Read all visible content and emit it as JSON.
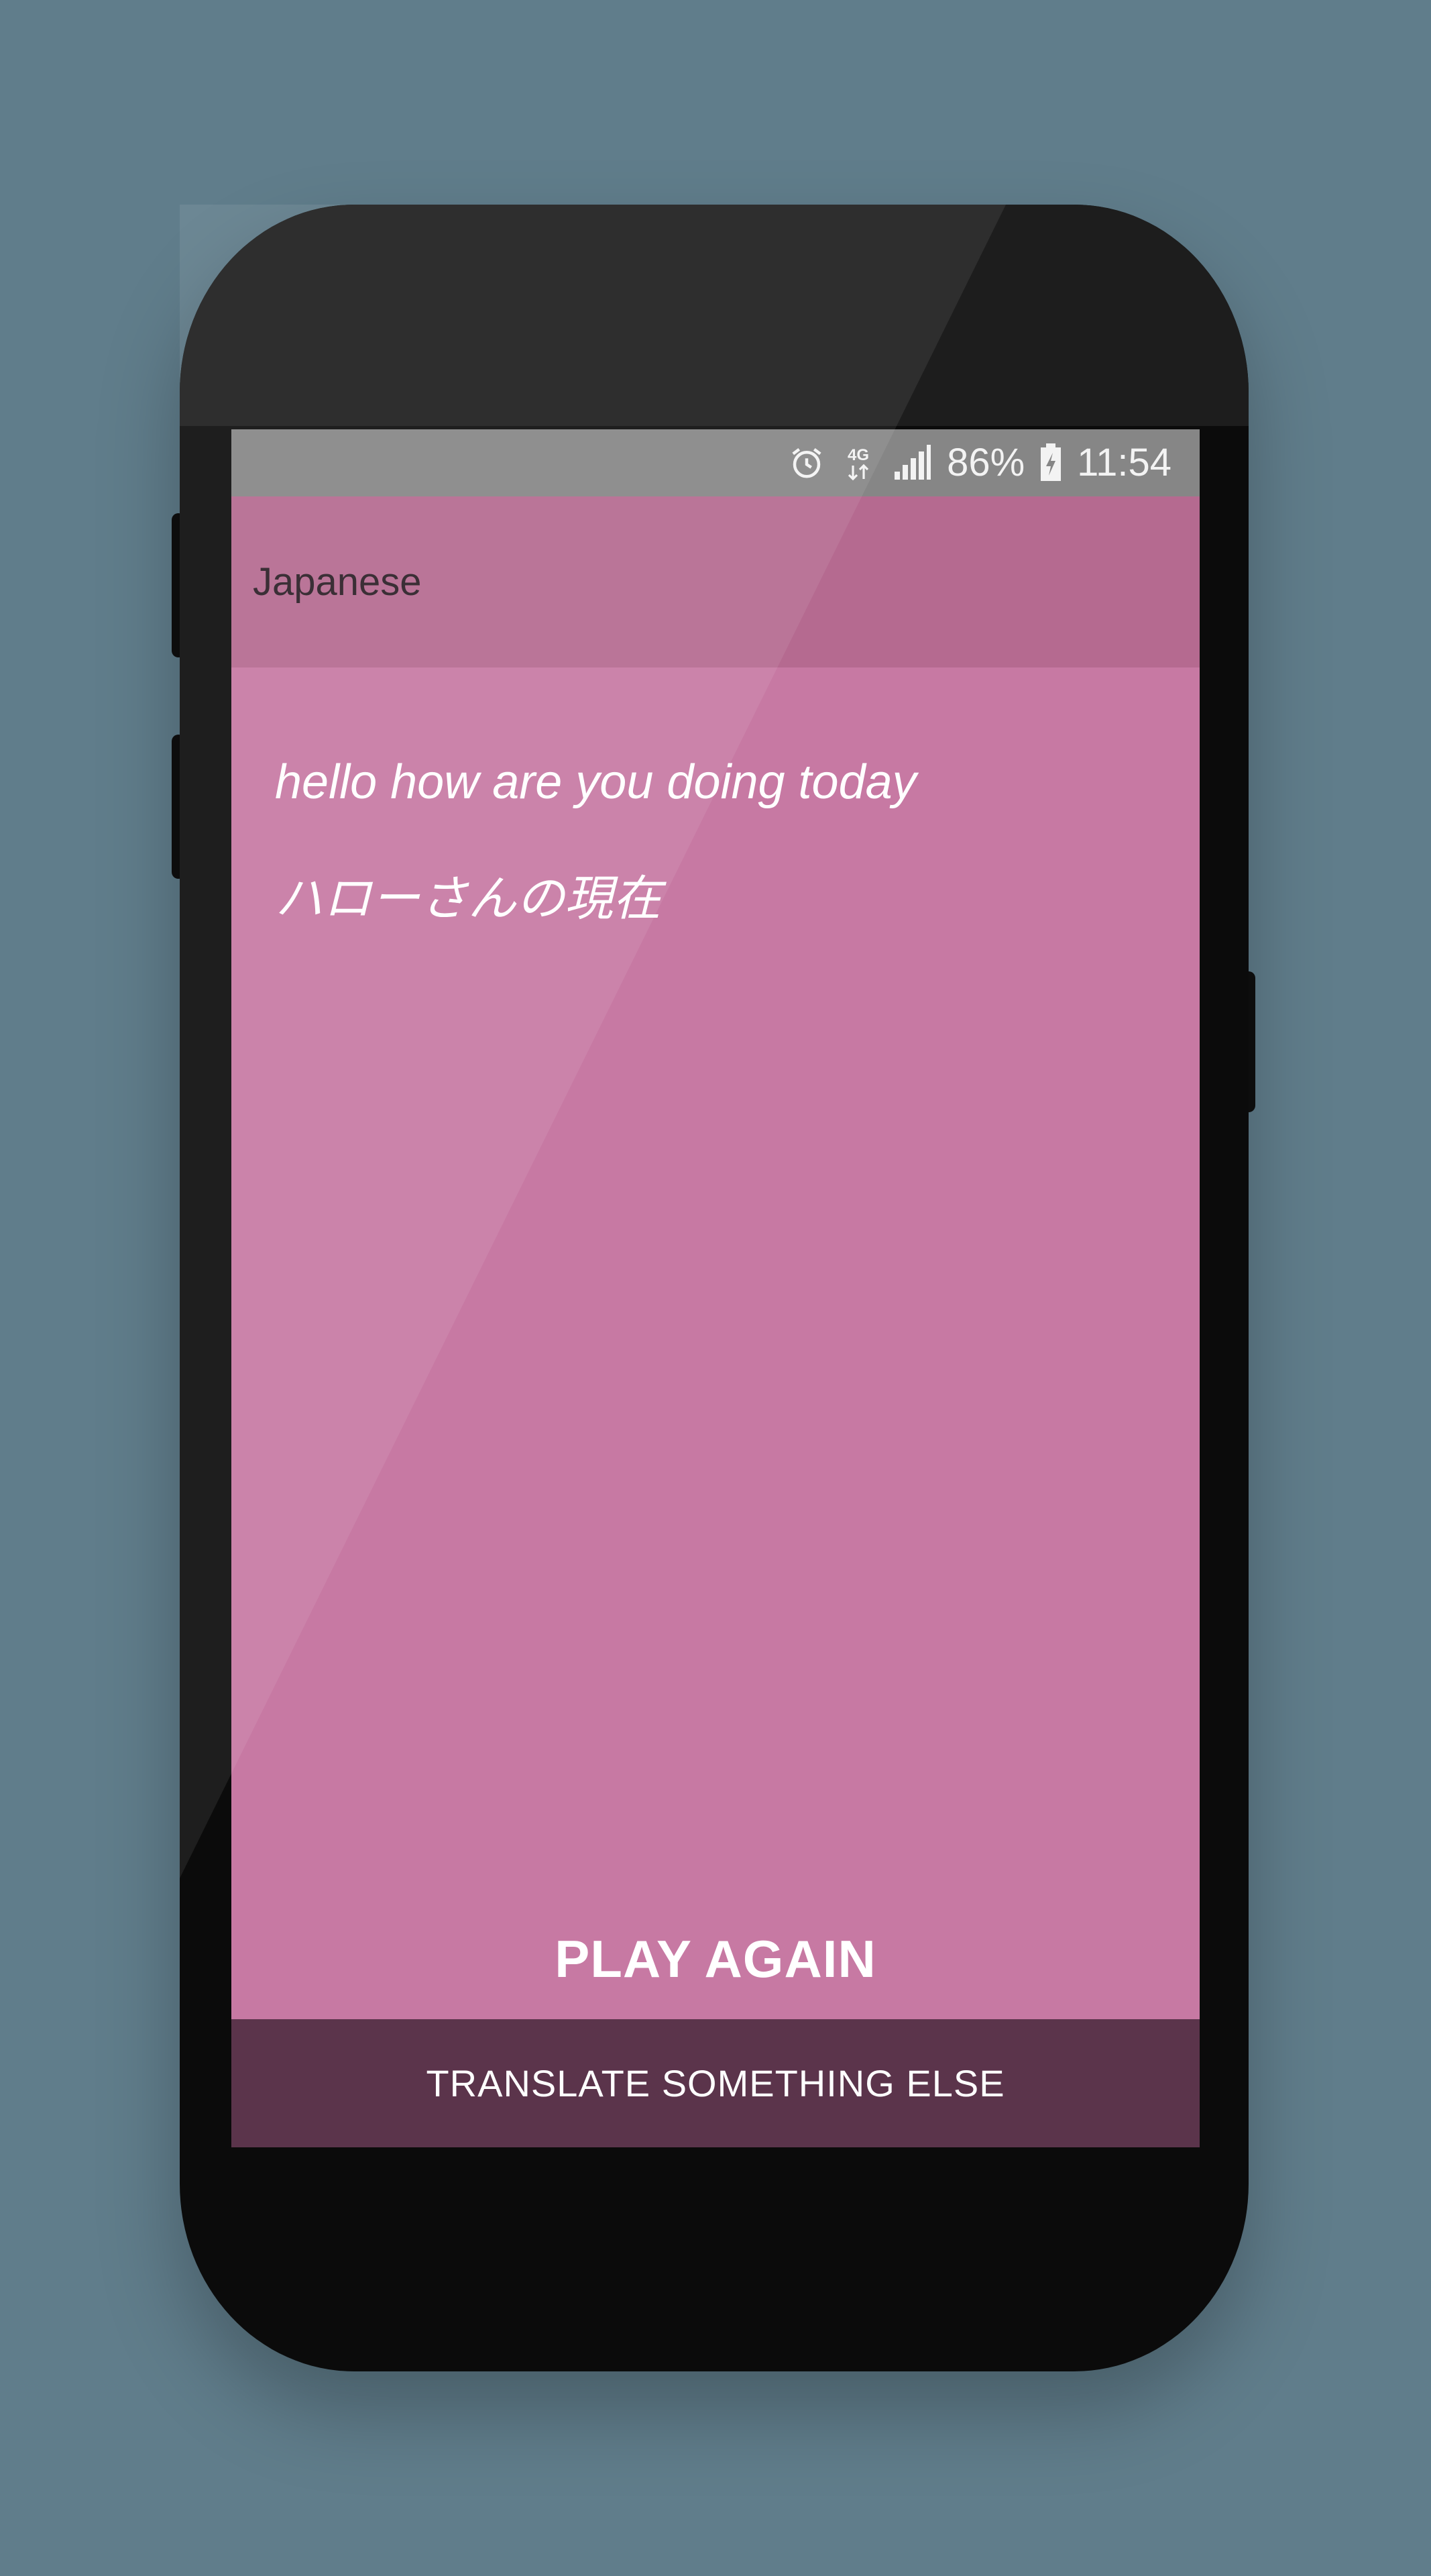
{
  "colors": {
    "background": "#607d8b",
    "screen": "#c779a3",
    "app_bar": "#b56a90",
    "status_bar": "#868686",
    "bottom_bar": "#5b344b"
  },
  "status_bar": {
    "icons": [
      "alarm-icon",
      "4g-icon",
      "signal-icon",
      "battery-charging-icon"
    ],
    "network_label": "4G",
    "battery": "86%",
    "time": "11:54"
  },
  "app_bar": {
    "title": "Japanese"
  },
  "content": {
    "source_text": "hello how are you doing today",
    "translated_text": "ハローさんの現在"
  },
  "actions": {
    "play_again": "PLAY AGAIN",
    "translate_something_else": "TRANSLATE SOMETHING ELSE"
  }
}
